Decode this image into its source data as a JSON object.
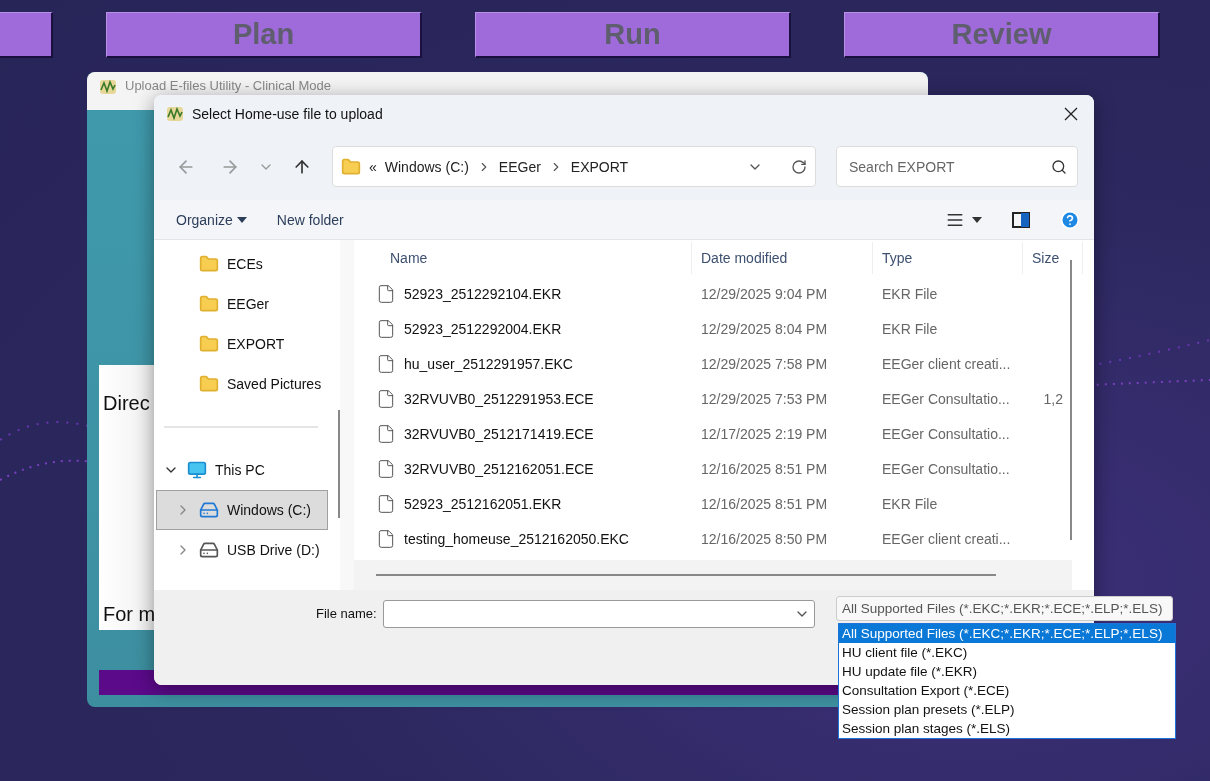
{
  "top_buttons": [
    {
      "label": "Plan"
    },
    {
      "label": "Run"
    },
    {
      "label": "Review"
    }
  ],
  "back_window": {
    "title": "Upload E-files Utility - Clinical Mode",
    "line_1": "Direc",
    "line_2": "For m"
  },
  "dialog": {
    "title": "Select Home-use file to upload",
    "address": {
      "overflow": "«",
      "path": [
        "Windows (C:)",
        "EEGer",
        "EXPORT"
      ]
    },
    "search": {
      "placeholder": "Search EXPORT"
    },
    "commands": [
      "Organize",
      "New folder"
    ],
    "nav": [
      {
        "label": "ECEs",
        "kind": "folder",
        "selected": false
      },
      {
        "label": "EEGer",
        "kind": "folder",
        "selected": false
      },
      {
        "label": "EXPORT",
        "kind": "folder",
        "selected": false
      },
      {
        "label": "Saved Pictures",
        "kind": "folder",
        "selected": false
      },
      {
        "label": "This PC",
        "kind": "pc",
        "expanded": true,
        "selected": false,
        "children": [
          {
            "label": "Windows (C:)",
            "kind": "windrive",
            "expanded": false,
            "selected": true
          },
          {
            "label": "USB Drive (D:)",
            "kind": "drive",
            "expanded": false,
            "selected": false
          }
        ]
      }
    ],
    "columns": [
      "Name",
      "Date modified",
      "Type",
      "Size"
    ],
    "files": [
      {
        "name": "52923_2512292104.EKR",
        "date": "12/29/2025 9:04 PM",
        "type": "EKR File"
      },
      {
        "name": "52923_2512292004.EKR",
        "date": "12/29/2025 8:04 PM",
        "type": "EKR File"
      },
      {
        "name": "hu_user_2512291957.EKC",
        "date": "12/29/2025 7:58 PM",
        "type": "EEGer client creati..."
      },
      {
        "name": "32RVUVB0_2512291953.ECE",
        "date": "12/29/2025 7:53 PM",
        "type": "EEGer Consultatio...",
        "size": "1,2"
      },
      {
        "name": "32RVUVB0_2512171419.ECE",
        "date": "12/17/2025 2:19 PM",
        "type": "EEGer Consultatio..."
      },
      {
        "name": "32RVUVB0_2512162051.ECE",
        "date": "12/16/2025 8:51 PM",
        "type": "EEGer Consultatio..."
      },
      {
        "name": "52923_2512162051.EKR",
        "date": "12/16/2025 8:51 PM",
        "type": "EKR File"
      },
      {
        "name": "testing_homeuse_2512162050.EKC",
        "date": "12/16/2025 8:50 PM",
        "type": "EEGer client creati..."
      }
    ],
    "file_name": {
      "label": "File name:"
    },
    "filter": {
      "value": "All Supported Files (*.EKC;*.EKR;*.ECE;*.ELP;*.ELS)",
      "options": [
        {
          "label": "All Supported Files (*.EKC;*.EKR;*.ECE;*.ELP;*.ELS)",
          "selected": true
        },
        {
          "label": "HU client file (*.EKC)",
          "selected": false
        },
        {
          "label": "HU update file (*.EKR)",
          "selected": false
        },
        {
          "label": "Consultation Export (*.ECE)",
          "selected": false
        },
        {
          "label": "Session plan presets (*.ELP)",
          "selected": false
        },
        {
          "label": "Session plan stages (*.ELS)",
          "selected": false
        }
      ]
    }
  }
}
